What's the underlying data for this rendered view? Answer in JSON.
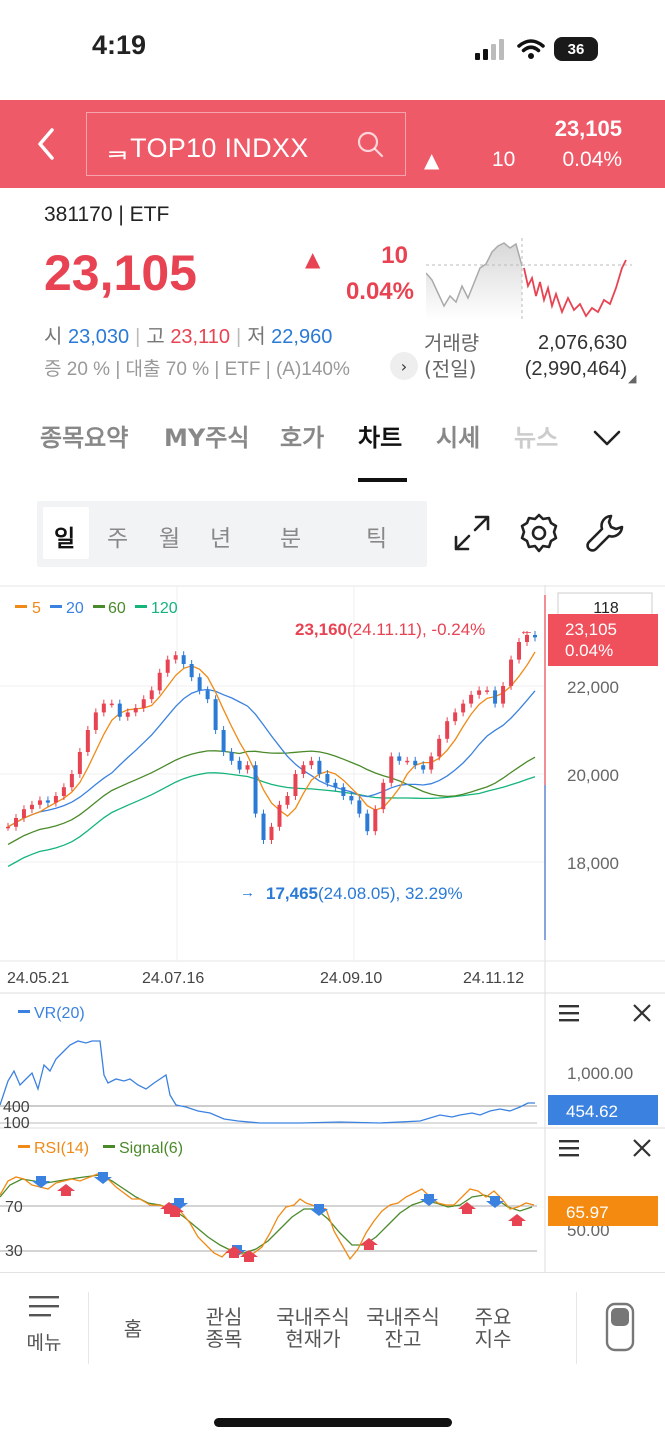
{
  "status": {
    "time": "4:19",
    "battery": "36"
  },
  "header": {
    "search_text": "ᆿTOP10 INDXX",
    "price": "23,105",
    "change": "10",
    "change_pct": "0.04%",
    "direction": "up",
    "bg_color": "#ee5a68"
  },
  "quote": {
    "code_line": "381170 | ETF",
    "price": "23,105",
    "change": "10",
    "change_pct": "0.04%",
    "open_label": "시",
    "open": "23,030",
    "high_label": "고",
    "high": "23,110",
    "low_label": "저",
    "low": "22,960",
    "info_line": "증 20 % | 대출 70 % | ETF | (A)140%",
    "volume_label_1": "거래량",
    "volume_label_2": "(전일)",
    "volume": "2,076,630",
    "prev_volume": "(2,990,464)"
  },
  "tabs": [
    "종목요약",
    "MY주식",
    "호가",
    "차트",
    "시세",
    "뉴스"
  ],
  "active_tab": "차트",
  "periods": [
    "일",
    "주",
    "월",
    "년",
    "분",
    "틱"
  ],
  "active_period": "일",
  "tools": [
    "expand-icon",
    "settings-gear-icon",
    "wrench-icon"
  ],
  "chart_data": {
    "type": "candlestick",
    "legend": [
      {
        "label": "5",
        "color": "#f08a16"
      },
      {
        "label": "20",
        "color": "#3b82e0"
      },
      {
        "label": "60",
        "color": "#4a8a2a"
      },
      {
        "label": "120",
        "color": "#14b47a"
      }
    ],
    "high_annotation": {
      "price": "23,160",
      "date": "(24.11.11)",
      "pct": ", -0.24%"
    },
    "low_annotation": {
      "price": "17,465",
      "date": "(24.08.05)",
      "pct": ", 32.29%"
    },
    "y_ticks": [
      "22,000",
      "20,000",
      "18,000"
    ],
    "y_top_value": "118",
    "current_price_tag": {
      "price": "23,105",
      "pct": "0.04%"
    },
    "x_ticks": [
      "24.05.21",
      "24.07.16",
      "24.09.10",
      "24.11.12"
    ],
    "closes": [
      18800,
      19000,
      19200,
      19300,
      19400,
      19350,
      19500,
      19700,
      20000,
      20500,
      21000,
      21400,
      21600,
      21600,
      21300,
      21400,
      21500,
      21700,
      21900,
      22300,
      22600,
      22700,
      22500,
      22200,
      21900,
      21700,
      21000,
      20500,
      20300,
      20100,
      20200,
      19100,
      18500,
      18800,
      19300,
      19500,
      20000,
      20200,
      20300,
      20000,
      19800,
      19700,
      19500,
      19400,
      19100,
      18700,
      19200,
      19800,
      20400,
      20300,
      20300,
      20200,
      20100,
      20400,
      20800,
      21200,
      21400,
      21600,
      21800,
      21900,
      21900,
      21600,
      22000,
      22600,
      23000,
      23160,
      23105
    ],
    "vr": {
      "label": "VR(20)",
      "color": "#3b82e0",
      "y_ticks": [
        "1,000.00",
        "400",
        "100"
      ],
      "current": "454.62"
    },
    "rsi": {
      "label": "RSI(14)",
      "rsi_color": "#f08a16",
      "signal_label": "Signal(6)",
      "signal_color": "#4a8a2a",
      "y_ticks": [
        "70",
        "30",
        "50.00"
      ],
      "current": "65.97"
    }
  },
  "bottom_nav": {
    "menu": "메뉴",
    "items": [
      "홈",
      "관심\n종목",
      "국내주식\n현재가",
      "국내주식\n잔고",
      "주요\n지수"
    ]
  }
}
